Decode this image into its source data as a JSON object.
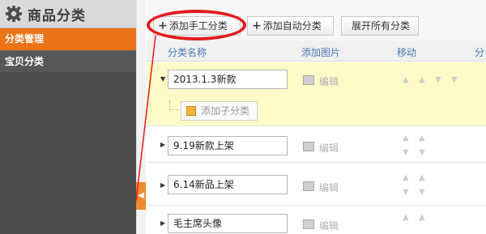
{
  "sidebar": {
    "title": "商品分类",
    "items": [
      {
        "label": "分类管理"
      },
      {
        "label": "宝贝分类"
      }
    ],
    "collapse_glyph": "◀"
  },
  "toolbar": {
    "add_manual": "添加手工分类",
    "add_auto": "添加自动分类",
    "expand_all": "展开所有分类",
    "plus_glyph": "+"
  },
  "table": {
    "headers": {
      "name": "分类名称",
      "image": "添加图片",
      "move": "移动",
      "ops": "分"
    },
    "rows": [
      {
        "name": "2013.1.3新款",
        "edit": "编辑",
        "expanded": true,
        "child_button": "添加子分类"
      },
      {
        "name": "9.19新款上架",
        "edit": "编辑"
      },
      {
        "name": "6.14新品上架",
        "edit": "编辑"
      },
      {
        "name": "毛主席头像",
        "edit": "编辑"
      }
    ]
  },
  "icons": {
    "up": "▲",
    "down": "▼",
    "expand": "▶",
    "expanded": "▼"
  },
  "colors": {
    "accent": "#ec7317",
    "highlight_row": "#fffbc9",
    "annotation": "#e21b1b",
    "header_text": "#4a79b5"
  }
}
